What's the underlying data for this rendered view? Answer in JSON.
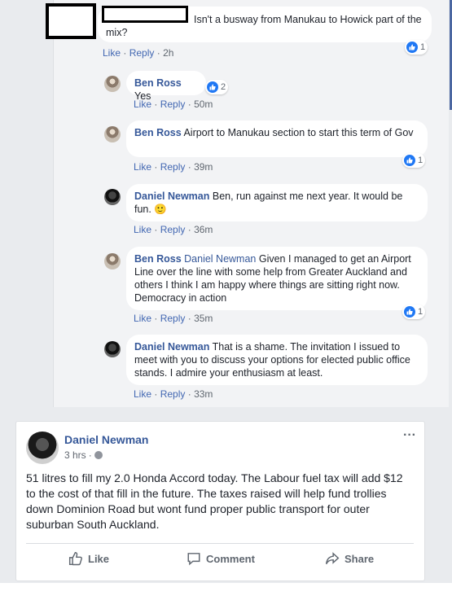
{
  "comments": [
    {
      "author": "",
      "text": "Isn't a busway from Manukau to Howick part of the mix?",
      "like": "Like",
      "reply": "Reply",
      "time": "2h",
      "reactions": "1"
    },
    {
      "author": "Ben Ross",
      "text": "Yes",
      "like": "Like",
      "reply": "Reply",
      "time": "50m",
      "reactions": "2"
    },
    {
      "author": "Ben Ross",
      "text": "Airport to Manukau section to start this term of Gov",
      "like": "Like",
      "reply": "Reply",
      "time": "39m",
      "reactions": "1"
    },
    {
      "author": "Daniel Newman",
      "text": "Ben, run against me next year. It would be fun.",
      "like": "Like",
      "reply": "Reply",
      "time": "36m"
    },
    {
      "author": "Ben Ross",
      "mention": "Daniel Newman",
      "text": "Given I managed to get an Airport Line over the line with some help from Greater Auckland and others I think I am happy where things are sitting right now. Democracy in action",
      "like": "Like",
      "reply": "Reply",
      "time": "35m",
      "reactions": "1"
    },
    {
      "author": "Daniel Newman",
      "text": "That is a shame. The invitation I issued to meet with you to discuss your options for elected public office stands. I admire your enthusiasm at least.",
      "like": "Like",
      "reply": "Reply",
      "time": "33m"
    }
  ],
  "post": {
    "author": "Daniel Newman",
    "time": "3 hrs",
    "more": "···",
    "body": "51 litres to fill my 2.0 Honda Accord today. The Labour fuel tax will add $12 to the cost of that fill in the future. The taxes raised will help fund trollies down Dominion Road but wont fund proper public transport for outer suburban South Auckland.",
    "actions": {
      "like": "Like",
      "comment": "Comment",
      "share": "Share"
    }
  },
  "meta_sep": "·",
  "emoji": "🙂",
  "icons": {
    "like": "thumbs-up-icon",
    "comment": "comment-icon",
    "share": "share-icon",
    "globe": "globe-icon"
  }
}
